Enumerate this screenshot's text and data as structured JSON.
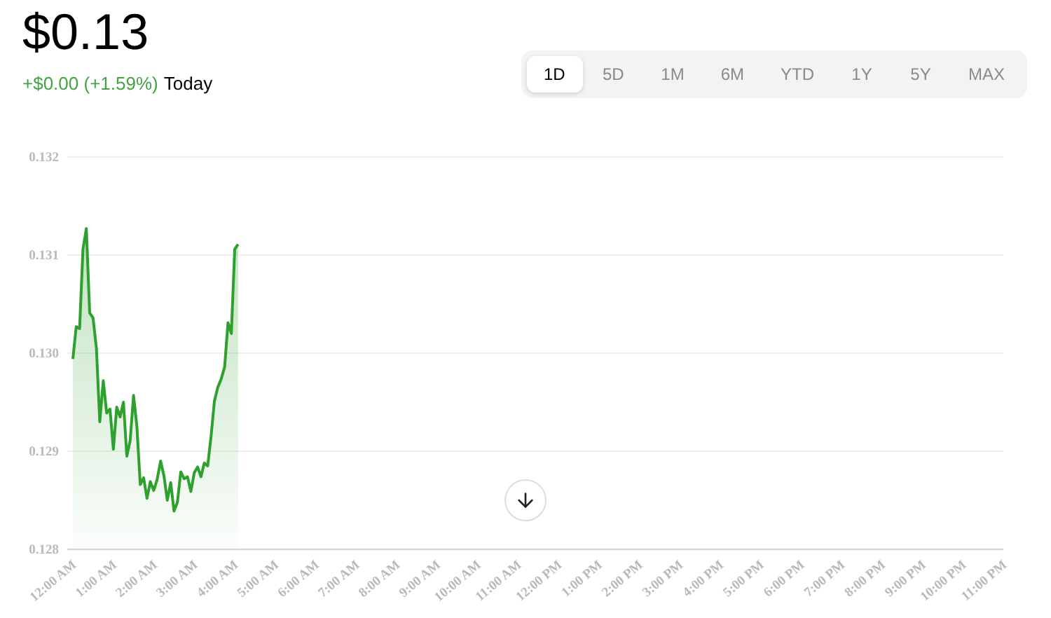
{
  "price": "$0.13",
  "change": {
    "amount": "+$0.00",
    "percent": "(+1.59%)",
    "period": "Today"
  },
  "ranges": [
    {
      "label": "1D",
      "selected": true
    },
    {
      "label": "5D",
      "selected": false
    },
    {
      "label": "1M",
      "selected": false
    },
    {
      "label": "6M",
      "selected": false
    },
    {
      "label": "YTD",
      "selected": false
    },
    {
      "label": "1Y",
      "selected": false
    },
    {
      "label": "5Y",
      "selected": false
    },
    {
      "label": "MAX",
      "selected": false
    }
  ],
  "chart": {
    "chart_data": {
      "type": "area",
      "x": [
        0,
        5,
        10,
        15,
        20,
        25,
        30,
        35,
        40,
        45,
        50,
        55,
        60,
        65,
        70,
        75,
        80,
        85,
        90,
        95,
        100,
        105,
        110,
        115,
        120,
        125,
        130,
        135,
        140,
        145,
        150,
        155,
        160,
        165,
        170,
        175,
        180,
        185,
        190,
        195,
        200,
        205,
        210,
        215,
        220,
        225,
        230,
        235,
        240,
        245
      ],
      "series": [
        {
          "color": "#2ea02e",
          "values": [
            0.12994,
            0.13027,
            0.13025,
            0.13106,
            0.13127,
            0.13041,
            0.13036,
            0.13005,
            0.1293,
            0.12972,
            0.12939,
            0.12943,
            0.12902,
            0.12945,
            0.12935,
            0.1295,
            0.12895,
            0.12911,
            0.12957,
            0.12925,
            0.12866,
            0.12873,
            0.12852,
            0.12869,
            0.1286,
            0.12871,
            0.1289,
            0.12875,
            0.1285,
            0.12868,
            0.12839,
            0.12848,
            0.12879,
            0.12872,
            0.12874,
            0.12859,
            0.12878,
            0.12884,
            0.12874,
            0.12888,
            0.12885,
            0.12915,
            0.12951,
            0.12965,
            0.12974,
            0.12986,
            0.13031,
            0.1302,
            0.13106,
            0.13111
          ]
        }
      ],
      "xlim": [
        0,
        1380
      ],
      "ylim": [
        0.128,
        0.132
      ],
      "grid": true,
      "yticks": [
        {
          "value": 0.128,
          "label": "0.128"
        },
        {
          "value": 0.129,
          "label": "0.129"
        },
        {
          "value": 0.13,
          "label": "0.130"
        },
        {
          "value": 0.131,
          "label": "0.131"
        },
        {
          "value": 0.132,
          "label": "0.132"
        }
      ],
      "xticks": [
        {
          "value": 0,
          "label": "12:00 AM"
        },
        {
          "value": 60,
          "label": "1:00 AM"
        },
        {
          "value": 120,
          "label": "2:00 AM"
        },
        {
          "value": 180,
          "label": "3:00 AM"
        },
        {
          "value": 240,
          "label": "4:00 AM"
        },
        {
          "value": 300,
          "label": "5:00 AM"
        },
        {
          "value": 360,
          "label": "6:00 AM"
        },
        {
          "value": 420,
          "label": "7:00 AM"
        },
        {
          "value": 480,
          "label": "8:00 AM"
        },
        {
          "value": 540,
          "label": "9:00 AM"
        },
        {
          "value": 600,
          "label": "10:00 AM"
        },
        {
          "value": 660,
          "label": "11:00 AM"
        },
        {
          "value": 720,
          "label": "12:00 PM"
        },
        {
          "value": 780,
          "label": "1:00 PM"
        },
        {
          "value": 840,
          "label": "2:00 PM"
        },
        {
          "value": 900,
          "label": "3:00 PM"
        },
        {
          "value": 960,
          "label": "4:00 PM"
        },
        {
          "value": 1020,
          "label": "5:00 PM"
        },
        {
          "value": 1080,
          "label": "6:00 PM"
        },
        {
          "value": 1140,
          "label": "7:00 PM"
        },
        {
          "value": 1200,
          "label": "8:00 PM"
        },
        {
          "value": 1260,
          "label": "9:00 PM"
        },
        {
          "value": 1320,
          "label": "10:00 PM"
        },
        {
          "value": 1380,
          "label": "11:00 PM"
        }
      ]
    }
  }
}
